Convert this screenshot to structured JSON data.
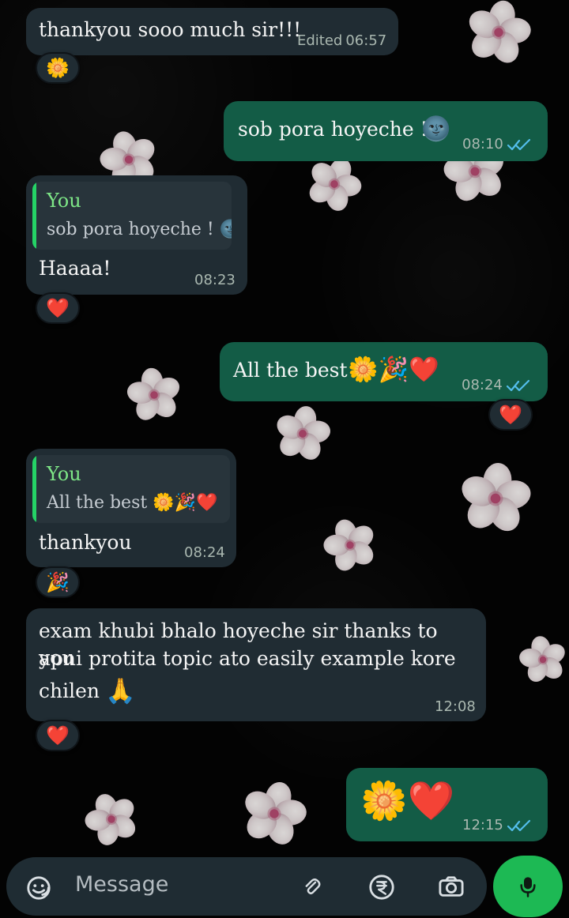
{
  "messages": [
    {
      "text": "thankyou sooo much sir!!!",
      "edited_label": "Edited",
      "time": "06:57",
      "reaction": "🌼"
    },
    {
      "text": "sob pora hoyeche !",
      "emoji": "🌚",
      "time": "08:10"
    },
    {
      "reply_name": "You",
      "reply_text": "sob pora hoyeche !",
      "reply_emoji": "🌚",
      "text": "Haaaa!",
      "time": "08:23",
      "reaction": "❤️"
    },
    {
      "text": "All the best",
      "emojis": "🌼🎉❤️",
      "time": "08:24",
      "reaction": "❤️"
    },
    {
      "reply_name": "You",
      "reply_text": "All the best",
      "reply_emojis": "🌼🎉❤️",
      "text": "thankyou",
      "time": "08:24",
      "reaction": "🎉"
    },
    {
      "lines": [
        "exam khubi bhalo hoyeche sir thanks to you",
        "apni protita topic ato easily example kore",
        "chilen"
      ],
      "line3_emoji": "🙏",
      "time": "12:08",
      "reaction": "❤️"
    },
    {
      "emojis": "🌼❤️",
      "time": "12:15"
    }
  ],
  "composer": {
    "placeholder": "Message"
  },
  "icons": {
    "emoji": "emoji-icon",
    "attach": "paperclip-icon",
    "currency": "rupee-icon",
    "camera": "camera-icon",
    "mic": "microphone-icon",
    "read_receipt": "double-check-icon"
  },
  "colors": {
    "incoming_bubble": "#202c33",
    "outgoing_bubble": "#135c46",
    "accent": "#25d366",
    "receipt_blue": "#53bdeb",
    "mic_button": "#1db954"
  }
}
